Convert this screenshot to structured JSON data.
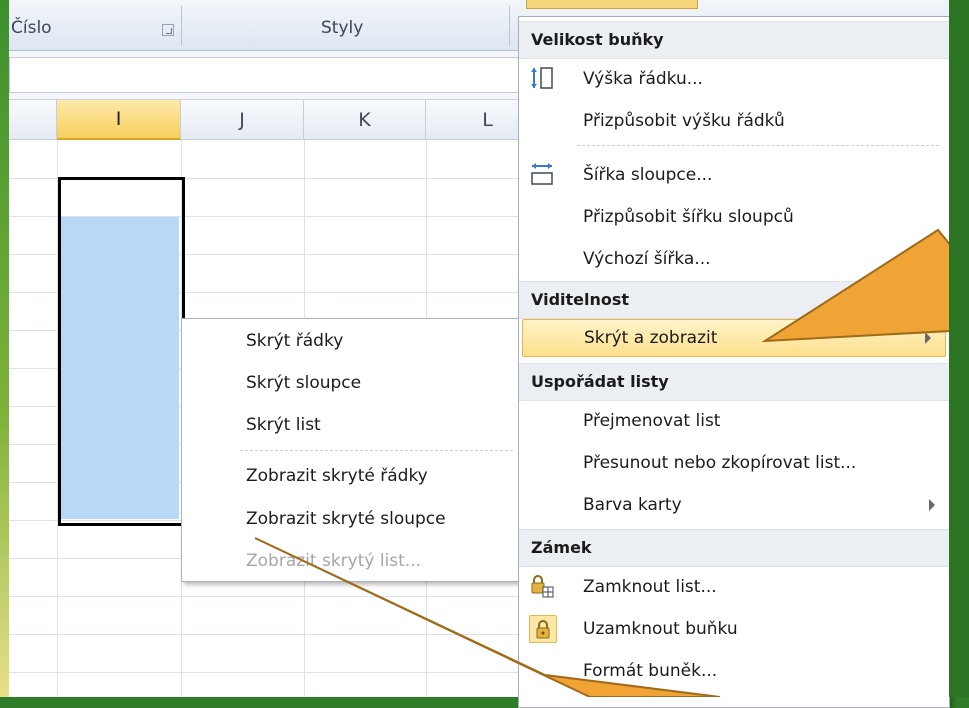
{
  "ribbon": {
    "group_number": "Číslo",
    "group_styles": "Styly"
  },
  "sheet": {
    "columns": [
      "I",
      "J",
      "K",
      "L"
    ],
    "active_column": "I"
  },
  "format_menu": {
    "sections": [
      {
        "header": "Velikost buňky",
        "items": [
          {
            "label": "Výška řádku...",
            "icon": "row-height-icon"
          },
          {
            "label": "Přizpůsobit výšku řádků"
          },
          {
            "label": "Šířka sloupce...",
            "icon": "column-width-icon"
          },
          {
            "label": "Přizpůsobit šířku sloupců"
          },
          {
            "label": "Výchozí šířka..."
          }
        ]
      },
      {
        "header": "Viditelnost",
        "items": [
          {
            "label": "Skrýt a zobrazit",
            "submenu": true,
            "highlighted": true
          }
        ]
      },
      {
        "header": "Uspořádat listy",
        "items": [
          {
            "label": "Přejmenovat list"
          },
          {
            "label": "Přesunout nebo zkopírovat list..."
          },
          {
            "label": "Barva karty",
            "submenu": true
          }
        ]
      },
      {
        "header": "Zámek",
        "items": [
          {
            "label": "Zamknout list...",
            "icon": "protect-sheet-icon"
          },
          {
            "label": "Uzamknout buňku",
            "icon": "lock-cell-icon"
          },
          {
            "label": "Formát buněk..."
          }
        ]
      }
    ]
  },
  "hide_submenu": {
    "items": [
      {
        "label": "Skrýt řádky"
      },
      {
        "label": "Skrýt sloupce"
      },
      {
        "label": "Skrýt list"
      },
      {
        "label": "Zobrazit skryté řádky"
      },
      {
        "label": "Zobrazit skryté sloupce"
      },
      {
        "label": "Zobrazit skrytý list...",
        "disabled": true
      }
    ]
  },
  "colors": {
    "callout": "#f0a436",
    "highlight": "#fde08c",
    "selection": "#b9d8f7",
    "frame": "#2f7d28"
  }
}
